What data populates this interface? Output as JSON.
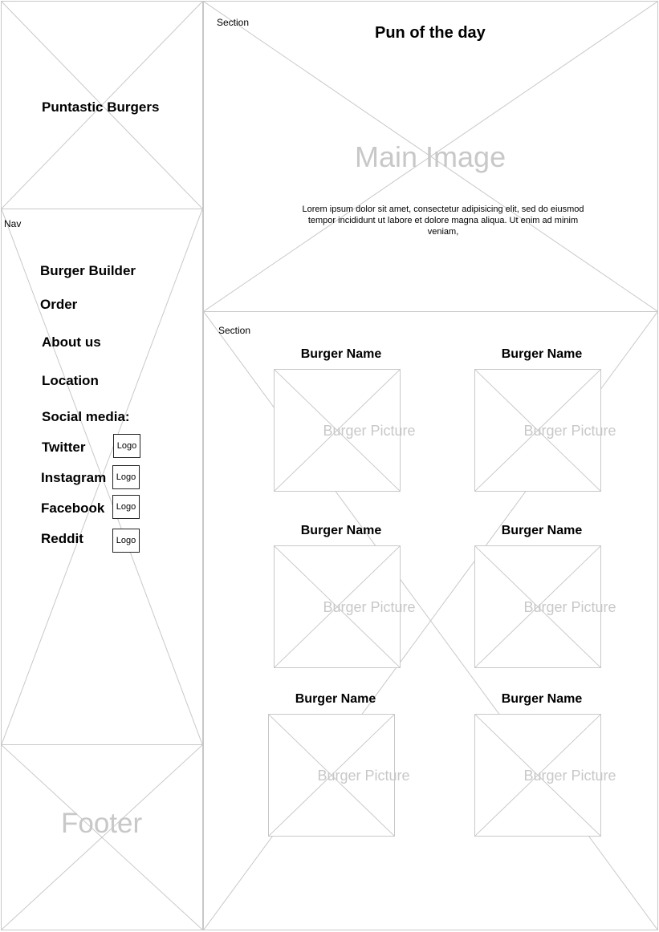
{
  "brand": {
    "title": "Puntastic Burgers"
  },
  "nav": {
    "tag": "Nav",
    "items": [
      "Burger Builder",
      "Order",
      "About us",
      "Location"
    ],
    "social_heading": "Social media:",
    "social": [
      {
        "label": "Twitter",
        "logo": "Logo"
      },
      {
        "label": "Instagram",
        "logo": "Logo"
      },
      {
        "label": "Facebook",
        "logo": "Logo"
      },
      {
        "label": "Reddit",
        "logo": "Logo"
      }
    ]
  },
  "footer": {
    "label": "Footer"
  },
  "hero": {
    "tag": "Section",
    "title": "Pun of the day",
    "image_label": "Main Image",
    "body": "Lorem ipsum dolor sit amet, consectetur adipisicing elit, sed do eiusmod tempor incididunt ut labore et dolore magna aliqua. Ut enim ad minim veniam,"
  },
  "menu": {
    "tag": "Section",
    "burgers": [
      {
        "name": "Burger Name",
        "picture": "Burger Picture"
      },
      {
        "name": "Burger Name",
        "picture": "Burger Picture"
      },
      {
        "name": "Burger Name",
        "picture": "Burger Picture"
      },
      {
        "name": "Burger Name",
        "picture": "Burger Picture"
      },
      {
        "name": "Burger Name",
        "picture": "Burger Picture"
      },
      {
        "name": "Burger Name",
        "picture": "Burger Picture"
      }
    ]
  }
}
